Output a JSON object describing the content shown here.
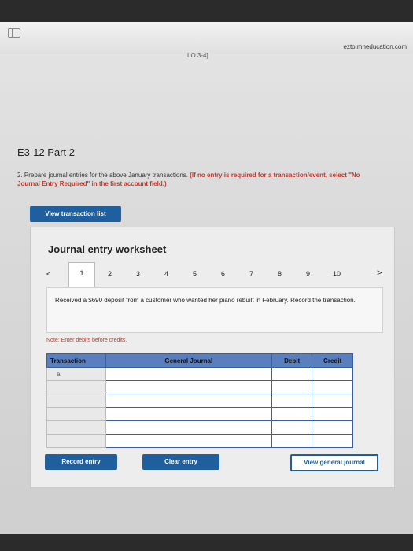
{
  "browser": {
    "url": "ezto.mheducation.com"
  },
  "lo_label": "LO 3-4]",
  "title": "E3-12 Part 2",
  "instructions": {
    "main": "2. Prepare journal entries for the above January transactions.",
    "note_red": "(If no entry is required for a transaction/event, select ",
    "note_bold": "\"No Journal Entry Required\"",
    "note_end": " in the first account field.)"
  },
  "view_transaction_button": "View transaction list",
  "worksheet": {
    "title": "Journal entry worksheet",
    "prev": "<",
    "next": ">",
    "pages": [
      "1",
      "2",
      "3",
      "4",
      "5",
      "6",
      "7",
      "8",
      "9",
      "10"
    ],
    "description": "Received a $690 deposit from a customer who wanted her piano rebuilt in February. Record the transaction.",
    "note": "Note: Enter debits before credits.",
    "table": {
      "headers": {
        "transaction": "Transaction",
        "account": "General Journal",
        "debit": "Debit",
        "credit": "Credit"
      },
      "rows": [
        {
          "transaction": "a.",
          "account": "",
          "debit": "",
          "credit": ""
        },
        {
          "transaction": "",
          "account": "",
          "debit": "",
          "credit": ""
        },
        {
          "transaction": "",
          "account": "",
          "debit": "",
          "credit": ""
        },
        {
          "transaction": "",
          "account": "",
          "debit": "",
          "credit": ""
        },
        {
          "transaction": "",
          "account": "",
          "debit": "",
          "credit": ""
        },
        {
          "transaction": "",
          "account": "",
          "debit": "",
          "credit": ""
        }
      ]
    },
    "buttons": {
      "record": "Record entry",
      "clear": "Clear entry",
      "view_journal": "View general journal"
    }
  },
  "colors": {
    "accent": "#1f5f9e",
    "header": "#5a7fbf",
    "note": "#c0392b"
  }
}
